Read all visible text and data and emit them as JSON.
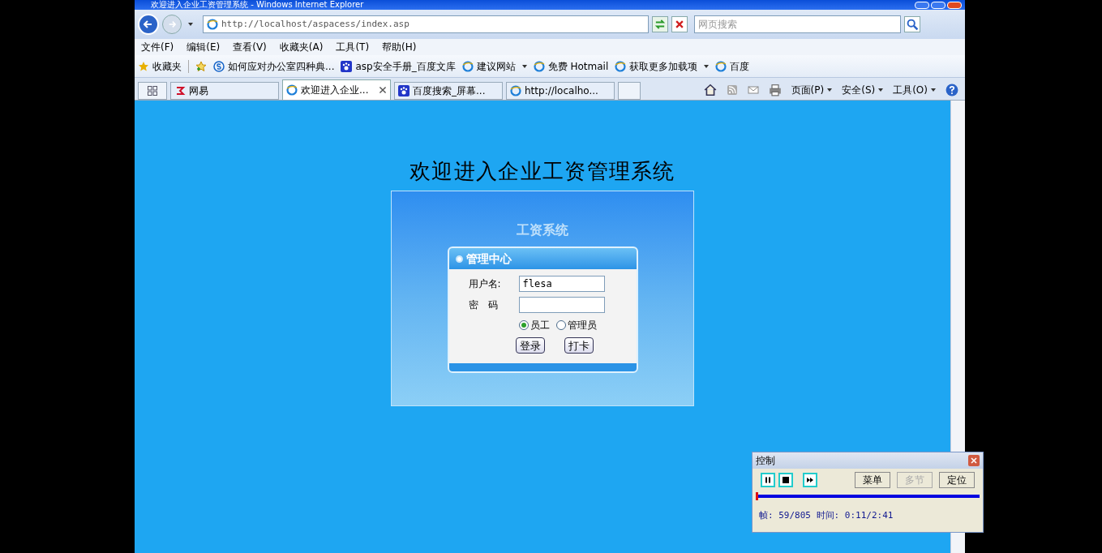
{
  "window": {
    "title": "欢迎进入企业工资管理系统 - Windows Internet Explorer"
  },
  "address_bar": {
    "url": "http://localhost/aspacess/index.asp"
  },
  "search": {
    "placeholder": "网页搜索"
  },
  "menu": [
    "文件(F)",
    "编辑(E)",
    "查看(V)",
    "收藏夹(A)",
    "工具(T)",
    "帮助(H)"
  ],
  "favorites_bar": {
    "label": "收藏夹",
    "items": [
      {
        "label": "如何应对办公室四种典...",
        "kind": "s",
        "dropdown": false
      },
      {
        "label": "asp安全手册_百度文库",
        "kind": "paw",
        "dropdown": false
      },
      {
        "label": "建议网站",
        "kind": "ie",
        "dropdown": true
      },
      {
        "label": "免费 Hotmail",
        "kind": "ie",
        "dropdown": false
      },
      {
        "label": "获取更多加载项",
        "kind": "ie",
        "dropdown": true
      },
      {
        "label": "百度",
        "kind": "ie",
        "dropdown": false
      }
    ]
  },
  "tabs": [
    {
      "label": "网易",
      "kind": "netease",
      "selected": false
    },
    {
      "label": "欢迎进入企业...",
      "kind": "ie",
      "selected": true
    },
    {
      "label": "百度搜索_屏幕...",
      "kind": "paw",
      "selected": false
    },
    {
      "label": "http://localho...",
      "kind": "ie",
      "selected": false
    }
  ],
  "command_bar": [
    "页面(P)",
    "安全(S)",
    "工具(O)"
  ],
  "page": {
    "heading": "欢迎进入企业工资管理系统",
    "banner": "工资系统",
    "panel_title": "管理中心",
    "fields": [
      {
        "label": "用户名:",
        "value": "flesa"
      },
      {
        "label": "密　码"
      }
    ],
    "roles": [
      {
        "label": "员工",
        "selected": true
      },
      {
        "label": "管理员",
        "selected": false
      }
    ],
    "buttons": [
      "登录",
      "打卡"
    ]
  },
  "player": {
    "title": "控制",
    "buttons": [
      {
        "label": "菜单",
        "disabled": false
      },
      {
        "label": "多节",
        "disabled": true
      },
      {
        "label": "定位",
        "disabled": false
      }
    ],
    "level": 0,
    "status": "帧: 59/805 时间: 0:11/2:41"
  }
}
